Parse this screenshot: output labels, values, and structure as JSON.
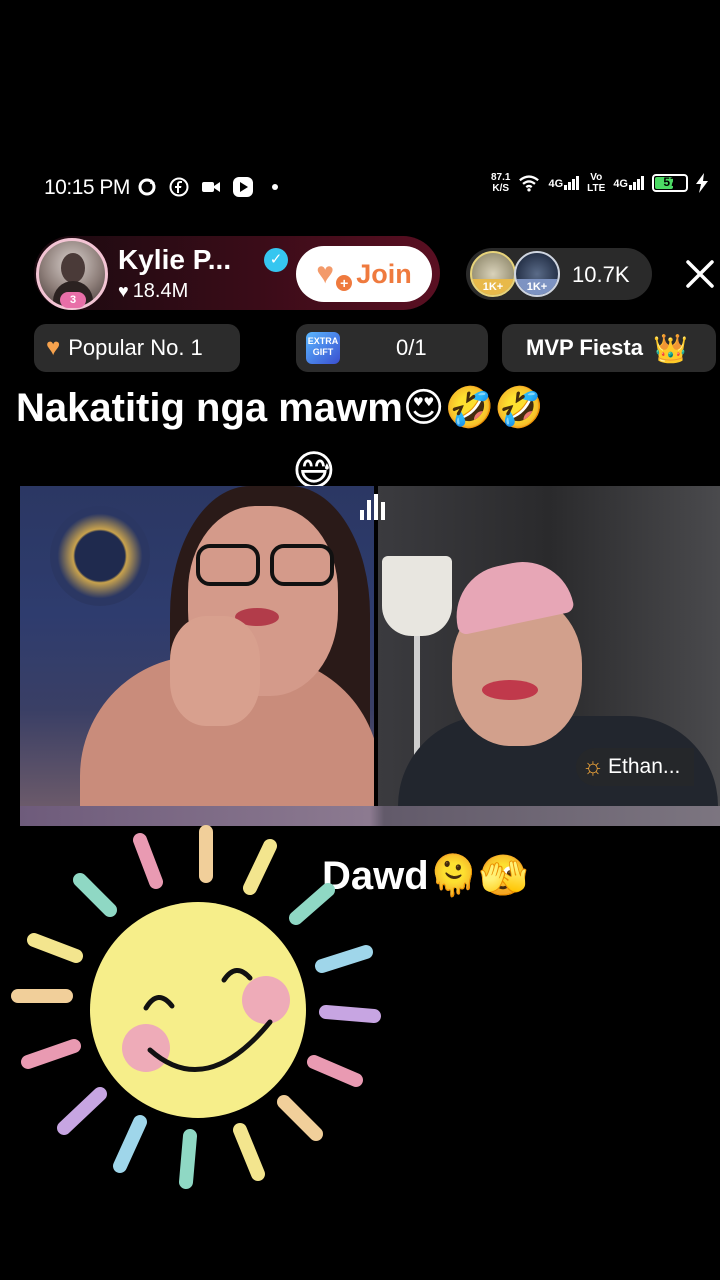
{
  "status_bar": {
    "time": "10:15 PM",
    "net_speed_value": "87.1",
    "net_speed_unit": "K/S",
    "signal1": "4G",
    "volte_top": "Vo",
    "volte_bottom": "LTE",
    "signal2": "4G",
    "battery": "57"
  },
  "host": {
    "name": "Kylie P...",
    "likes": "18.4M",
    "avatar_badge": "3",
    "join_label": "Join"
  },
  "viewers": {
    "avatar1_tag": "1K+",
    "avatar2_tag": "1K+",
    "count": "10.7K"
  },
  "badges": {
    "popular": "Popular No. 1",
    "progress_icon_text": "EXTRA GIFT",
    "progress": "0/1",
    "mvp": "MVP Fiesta"
  },
  "captions": {
    "line1": "Nakatitig nga mawm😍🤣🤣",
    "line1_emoji": "😅",
    "line2": "Dawd🫠🫣"
  },
  "guest": {
    "name": "Ethan..."
  },
  "icons": [
    "sync-icon",
    "facebook-icon",
    "video-icon",
    "play-icon",
    "wifi-icon",
    "heart-icon",
    "close-icon",
    "crown-icon",
    "audio-bars-icon",
    "sun-icon"
  ],
  "colors": {
    "join_accent": "#ef7a3e",
    "verified": "#36c6f0",
    "battery": "#4cd964",
    "crown": "#f4c342"
  }
}
